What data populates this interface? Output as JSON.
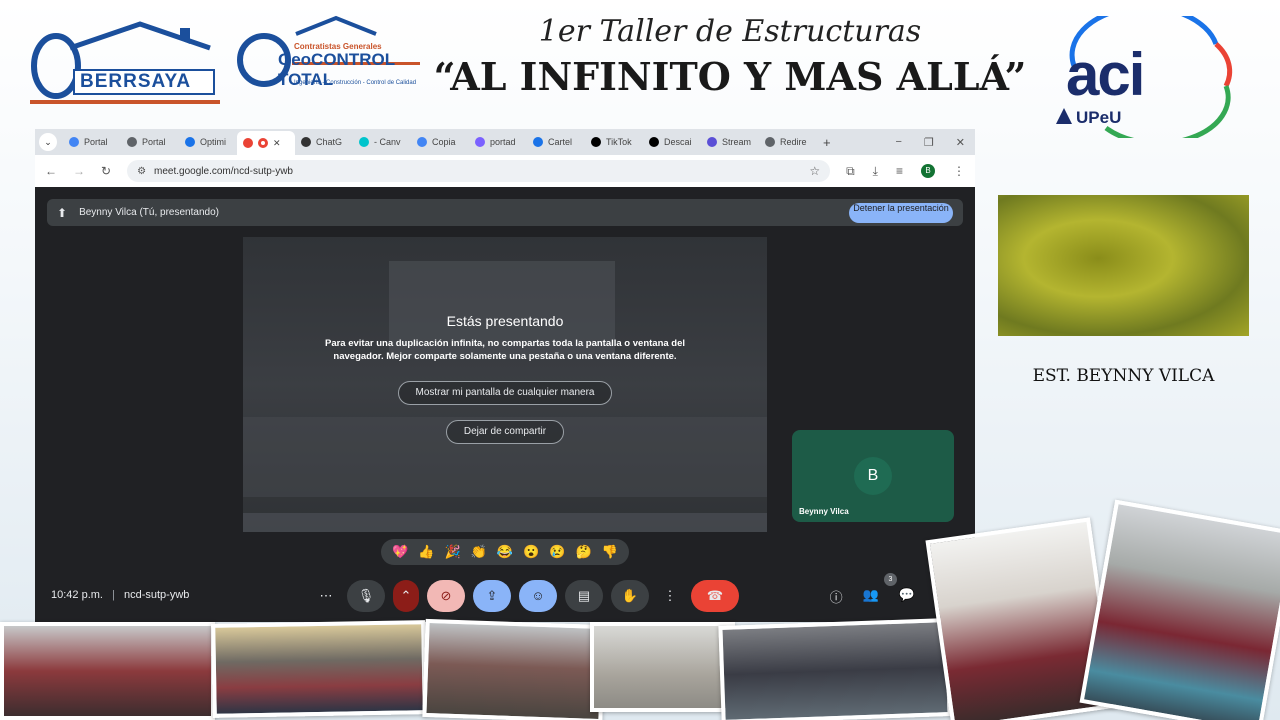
{
  "banner": {
    "left_logo_1": "BERRSAYA",
    "left_logo_2_top": "Contratistas Generales",
    "left_logo_2_main": "GeoCONTROL TOTAL",
    "left_logo_2_sub": "Ingeniería - Construcción - Control de Calidad",
    "subtitle": "1er Taller de Estructuras",
    "title": "“AL INFINITO Y MAS ALLÁ”",
    "right_logo_main": "aci",
    "right_logo_sub": "UPeU"
  },
  "browser": {
    "tabs": [
      {
        "label": "Portal",
        "color": "#4285f4"
      },
      {
        "label": "Portal",
        "color": "#5f6368"
      },
      {
        "label": "Optimi",
        "color": "#1a73e8"
      },
      {
        "label": "",
        "color": "#ea4335",
        "active": true
      },
      {
        "label": "ChatG",
        "color": "#333333"
      },
      {
        "label": "- Canv",
        "color": "#00c4cc"
      },
      {
        "label": "Copia",
        "color": "#4285f4"
      },
      {
        "label": "portad",
        "color": "#7b61ff"
      },
      {
        "label": "Cartel",
        "color": "#1a73e8"
      },
      {
        "label": "TikTok",
        "color": "#000000"
      },
      {
        "label": "Descai",
        "color": "#000000"
      },
      {
        "label": "Stream",
        "color": "#5b4fd6"
      },
      {
        "label": "Redire",
        "color": "#5f6368"
      }
    ],
    "new_tab": "+",
    "url": "meet.google.com/ncd-sutp-ywb",
    "profile_initial": "B"
  },
  "meet": {
    "presenter_label": "Beynny Vilca (Tú, presentando)",
    "stop_button": "Detener la presentación",
    "overlay": {
      "title": "Estás presentando",
      "description": "Para evitar una duplicación infinita, no compartas toda la pantalla o ventana del navegador. Mejor comparte solamente una pestaña o una ventana diferente.",
      "show_button": "Mostrar mi pantalla de cualquier manera",
      "stop_sharing_button": "Dejar de compartir"
    },
    "tile": {
      "initial": "B",
      "name": "Beynny Vilca"
    },
    "reactions": [
      "💖",
      "👍",
      "🎉",
      "👏",
      "😂",
      "😮",
      "😢",
      "🤔",
      "👎"
    ],
    "time": "10:42 p.m.",
    "meeting_code": "ncd-sutp-ywb",
    "participants_count": "3"
  },
  "presenter_name": "EST. BEYNNY VILCA"
}
